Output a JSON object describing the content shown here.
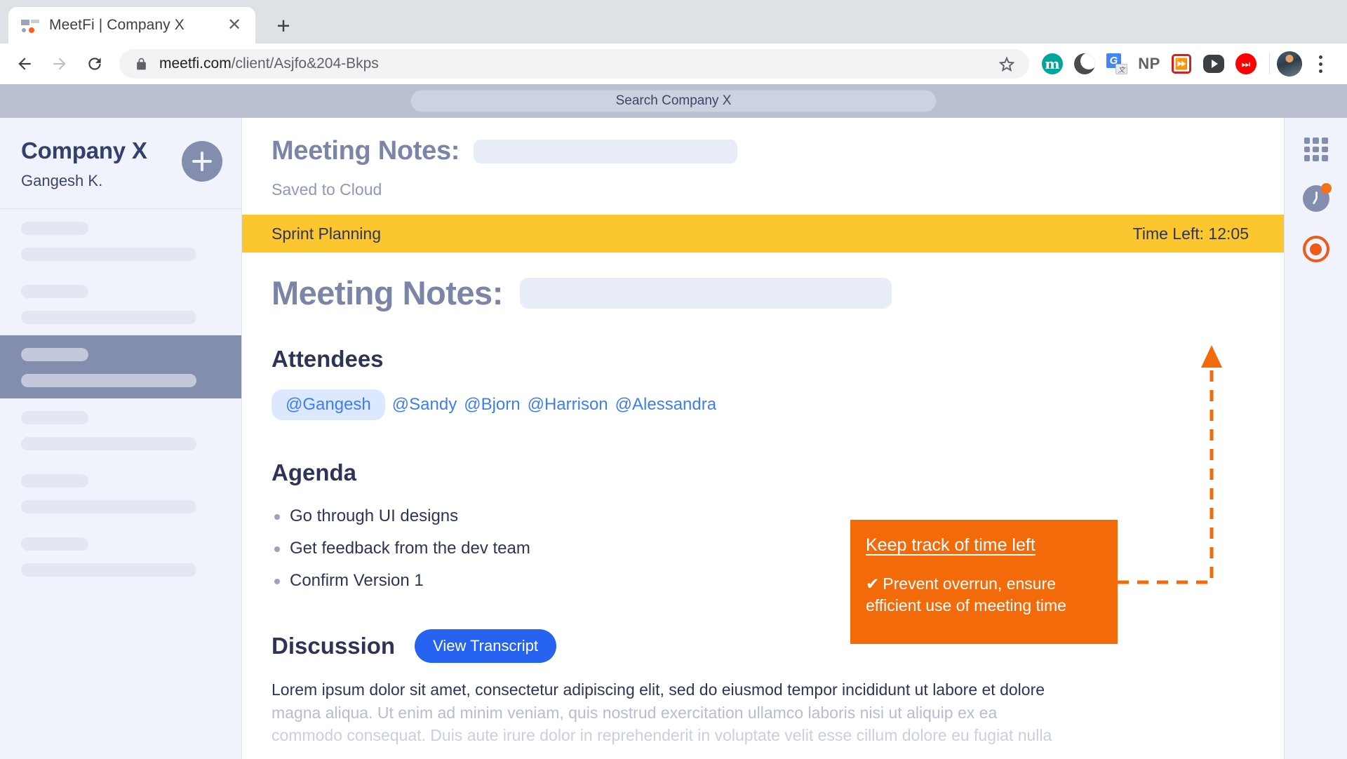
{
  "browser": {
    "tab": {
      "title": "MeetFi | Company X",
      "favicon": "meetfi-favicon",
      "close_label": "✕"
    },
    "new_tab_label": "+",
    "url": {
      "scheme_secure": true,
      "domain": "meetfi.com",
      "path": "/client/Asjfo&204-Bkps"
    },
    "extensions": [
      {
        "name": "mastodon-extension-icon",
        "label": "m"
      },
      {
        "name": "dark-reader-extension-icon",
        "label": ""
      },
      {
        "name": "google-translate-extension-icon",
        "label": "G"
      },
      {
        "name": "np-extension-icon",
        "label": "NP"
      },
      {
        "name": "video-speed-controller-extension-icon",
        "label": "⏩"
      },
      {
        "name": "youtube-extension-icon",
        "label": ""
      },
      {
        "name": "youtube-music-extension-icon",
        "label": "⏭"
      }
    ]
  },
  "app": {
    "search": {
      "placeholder": "Search Company X",
      "value": "Search Company X"
    },
    "sidebar": {
      "company": "Company X",
      "user": "Gangesh K.",
      "add_button_label": "+",
      "items": [
        {
          "active": false
        },
        {
          "active": false
        },
        {
          "active": true
        },
        {
          "active": false
        },
        {
          "active": false
        },
        {
          "active": false
        }
      ]
    },
    "doc_header": {
      "title": "Meeting Notes:",
      "title_value": "",
      "status": "Saved to Cloud"
    },
    "timer": {
      "meeting_name": "Sprint Planning",
      "time_left": "Time Left: 12:05",
      "bar_color": "#fcc72e"
    },
    "document": {
      "title": "Meeting Notes:",
      "title_value": "",
      "attendees_heading": "Attendees",
      "attendees": [
        "@Gangesh",
        "@Sandy",
        "@Bjorn",
        "@Harrison",
        "@Alessandra"
      ],
      "agenda_heading": "Agenda",
      "agenda": [
        "Go through UI designs",
        "Get feedback from the dev team",
        "Confirm Version 1"
      ],
      "discussion_heading": "Discussion",
      "view_transcript_label": "View Transcript",
      "lorem_line1": "Lorem ipsum dolor sit amet, consectetur adipiscing elit, sed do eiusmod tempor incididunt ut labore et dolore",
      "lorem_line2": "magna aliqua. Ut enim ad minim veniam, quis nostrud exercitation ullamco laboris nisi ut aliquip ex ea",
      "lorem_line3": "commodo consequat. Duis aute irure dolor in reprehenderit in voluptate velit esse cillum dolore eu fugiat nulla"
    },
    "right_rail": [
      {
        "icon": "apps-grid-icon",
        "badge": false
      },
      {
        "icon": "clock-timer-icon",
        "badge": true
      },
      {
        "icon": "record-icon",
        "badge": false
      }
    ],
    "callout": {
      "title": "Keep track of time left",
      "check": "✔",
      "body": "Prevent overrun, ensure efficient use of meeting time",
      "color": "#f26a0a"
    }
  }
}
